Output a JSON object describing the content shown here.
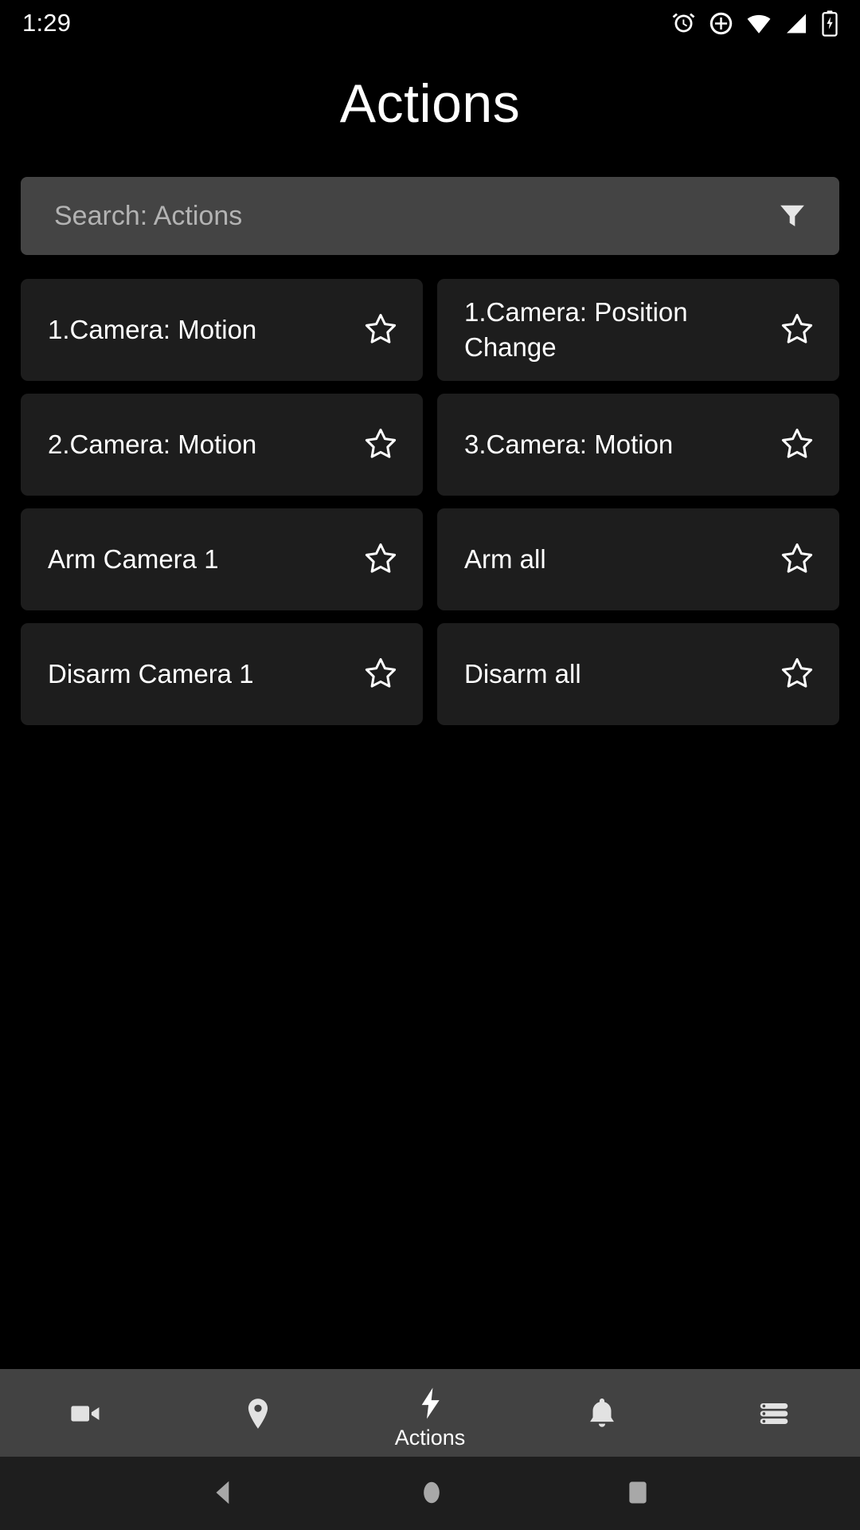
{
  "status_bar": {
    "time": "1:29",
    "icons": [
      "alarm-icon",
      "location-icon",
      "wifi-icon",
      "signal-icon",
      "battery-charging-icon"
    ]
  },
  "header": {
    "title": "Actions"
  },
  "search": {
    "placeholder": "Search: Actions",
    "value": "",
    "filter_icon": "filter-icon"
  },
  "actions": {
    "items": [
      {
        "label": "1.Camera: Motion",
        "favorite": false,
        "star_icon": "star-outline-icon"
      },
      {
        "label": "1.Camera: Position Change",
        "favorite": false,
        "star_icon": "star-outline-icon"
      },
      {
        "label": "2.Camera: Motion",
        "favorite": false,
        "star_icon": "star-outline-icon"
      },
      {
        "label": "3.Camera: Motion",
        "favorite": false,
        "star_icon": "star-outline-icon"
      },
      {
        "label": "Arm Camera 1",
        "favorite": false,
        "star_icon": "star-outline-icon"
      },
      {
        "label": "Arm all",
        "favorite": false,
        "star_icon": "star-outline-icon"
      },
      {
        "label": "Disarm Camera 1",
        "favorite": false,
        "star_icon": "star-outline-icon"
      },
      {
        "label": "Disarm all",
        "favorite": false,
        "star_icon": "star-outline-icon"
      }
    ]
  },
  "tab_bar": {
    "items": [
      {
        "label": "",
        "icon": "video-camera-icon",
        "active": false
      },
      {
        "label": "",
        "icon": "location-pin-icon",
        "active": false
      },
      {
        "label": "Actions",
        "icon": "lightning-bolt-icon",
        "active": true
      },
      {
        "label": "",
        "icon": "bell-icon",
        "active": false
      },
      {
        "label": "",
        "icon": "list-menu-icon",
        "active": false
      }
    ]
  },
  "android_nav": {
    "back": "back-triangle-icon",
    "home": "home-circle-icon",
    "recents": "recents-square-icon"
  },
  "colors": {
    "background": "#000000",
    "card": "#1d1d1d",
    "search_bar": "#444444",
    "tab_bar": "#424242",
    "android_nav": "#1e1e1e",
    "text_primary": "#ffffff",
    "text_placeholder": "#b3b3b3",
    "nav_icon": "#a8a8a8"
  }
}
